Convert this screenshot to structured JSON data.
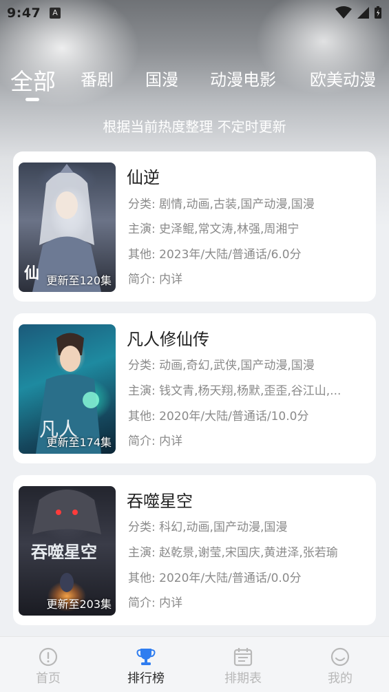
{
  "status_bar": {
    "time": "9:47",
    "notification_letter": "A"
  },
  "tabs": [
    {
      "label": "全部",
      "active": true
    },
    {
      "label": "番剧",
      "active": false
    },
    {
      "label": "国漫",
      "active": false
    },
    {
      "label": "动漫电影",
      "active": false
    },
    {
      "label": "欧美动漫",
      "active": false
    }
  ],
  "subtitle": "根据当前热度整理 不定时更新",
  "labels": {
    "category": "分类:",
    "cast": "主演:",
    "other": "其他:",
    "intro": "简介:"
  },
  "cards": [
    {
      "title": "仙逆",
      "poster_caption": "更新至120集",
      "category": "剧情,动画,古装,国产动漫,国漫",
      "cast": "史泽鲲,常文涛,林强,周湘宁",
      "other": "2023年/大陆/普通话/6.0分",
      "intro": "内详"
    },
    {
      "title": "凡人修仙传",
      "poster_caption": "更新至174集",
      "category": "动画,奇幻,武侠,国产动漫,国漫",
      "cast": "钱文青,杨天翔,杨默,歪歪,谷江山,...",
      "other": "2020年/大陆/普通话/10.0分",
      "intro": "内详"
    },
    {
      "title": "吞噬星空",
      "poster_caption": "更新至203集",
      "category": "科幻,动画,国产动漫,国漫",
      "cast": "赵乾景,谢莹,宋国庆,黄进泽,张若瑜",
      "other": "2020年/大陆/普通话/0.0分",
      "intro": "内详"
    }
  ],
  "bottom_nav": [
    {
      "label": "首页",
      "icon": "home-icon",
      "active": false
    },
    {
      "label": "排行榜",
      "icon": "trophy-icon",
      "active": true
    },
    {
      "label": "排期表",
      "icon": "calendar-icon",
      "active": false
    },
    {
      "label": "我的",
      "icon": "smiley-icon",
      "active": false
    }
  ],
  "colors": {
    "accent": "#2f7df0",
    "inactive": "#b8b8b8"
  }
}
